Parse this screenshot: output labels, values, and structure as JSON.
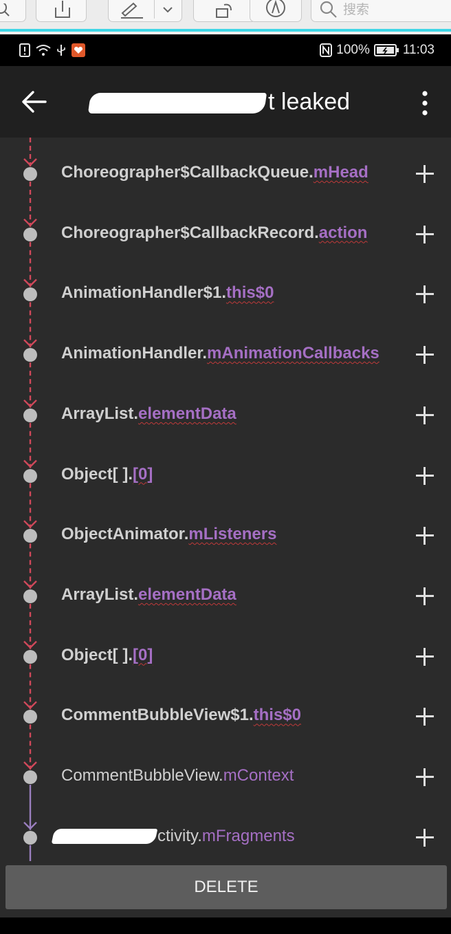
{
  "toolbar": {
    "search_placeholder": "搜索"
  },
  "status_bar": {
    "battery_percent": "100%",
    "time": "11:03"
  },
  "app_bar": {
    "title_visible": "t leaked"
  },
  "trace": {
    "rows": [
      {
        "class": "Choreographer$CallbackQueue.",
        "field": "mHead",
        "bold": true
      },
      {
        "class": "Choreographer$CallbackRecord.",
        "field": "action",
        "bold": true
      },
      {
        "class": "AnimationHandler$1.",
        "field": "this$0",
        "bold": true
      },
      {
        "class": "AnimationHandler.",
        "field": "mAnimationCallbacks",
        "bold": true
      },
      {
        "class": "ArrayList.",
        "field": "elementData",
        "bold": true
      },
      {
        "class": "Object[ ].",
        "field": "[0]",
        "bold": true
      },
      {
        "class": "ObjectAnimator.",
        "field": "mListeners",
        "bold": true
      },
      {
        "class": "ArrayList.",
        "field": "elementData",
        "bold": true
      },
      {
        "class": "Object[ ].",
        "field": "[0]",
        "bold": true
      },
      {
        "class": "CommentBubbleView$1.",
        "field": "this$0",
        "bold": true
      },
      {
        "class": "CommentBubbleView.",
        "field": "mContext",
        "bold": false
      },
      {
        "class": "ctivity.",
        "field": "mFragments",
        "bold": false
      }
    ]
  },
  "delete_label": "DELETE",
  "colors": {
    "field_purple": "#a56fc4",
    "leak_red": "#d0485a",
    "safe_purple": "#9b7fc0"
  }
}
